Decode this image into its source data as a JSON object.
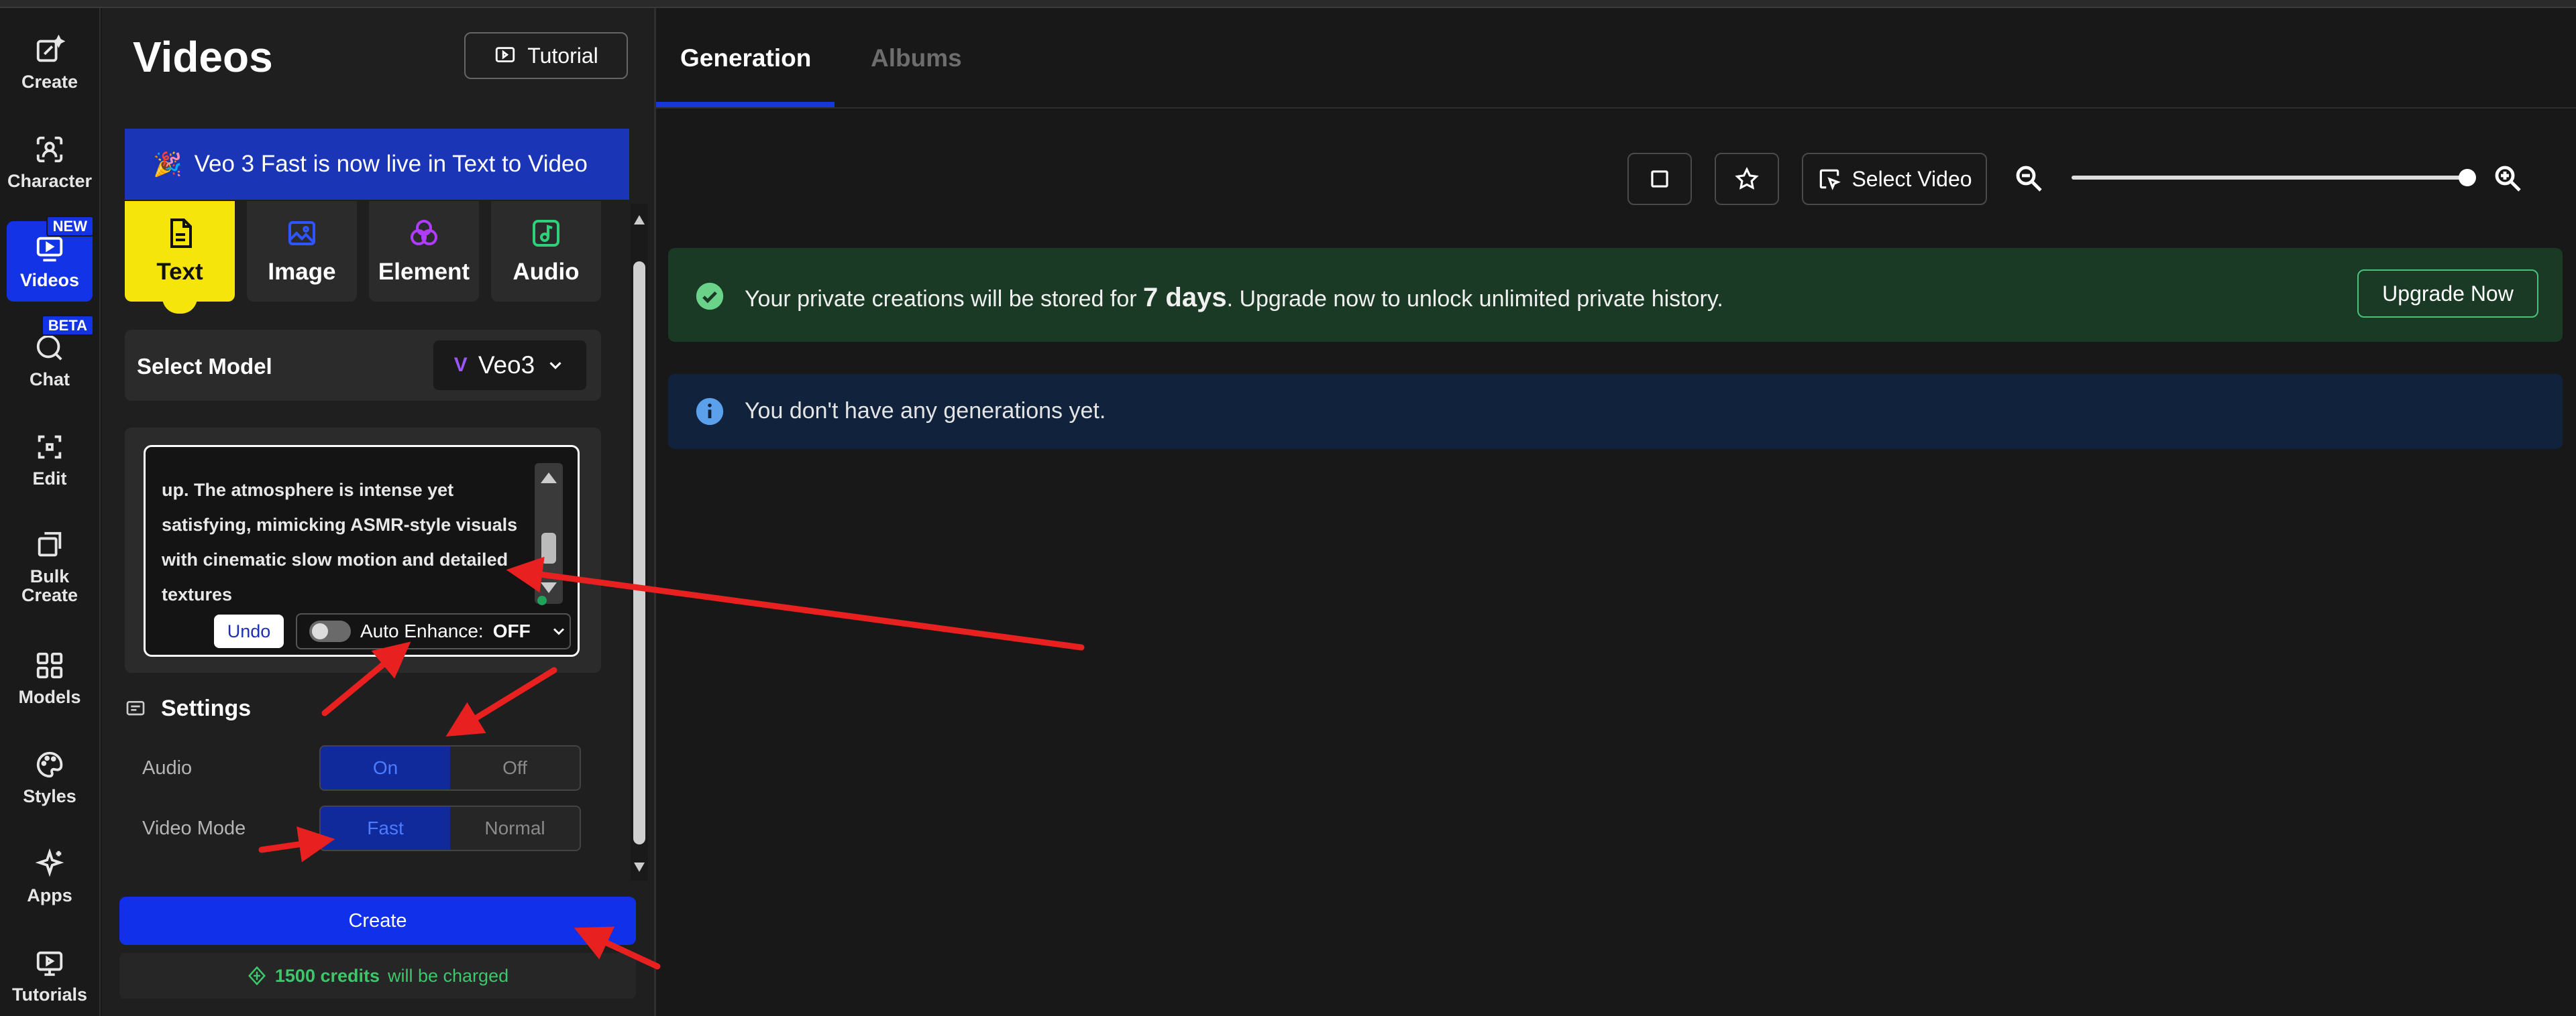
{
  "rail": {
    "items": [
      {
        "label": "Create",
        "icon": "sparkle-edit-icon"
      },
      {
        "label": "Character",
        "icon": "character-scan-icon"
      },
      {
        "label": "Videos",
        "icon": "video-icon",
        "badge": "NEW",
        "active": true
      },
      {
        "label": "Chat",
        "icon": "chat-icon",
        "badge": "BETA"
      },
      {
        "label": "Edit",
        "icon": "edit-crop-icon"
      },
      {
        "label": "Bulk\nCreate",
        "icon": "bulk-create-icon"
      },
      {
        "label": "Models",
        "icon": "grid-icon"
      },
      {
        "label": "Styles",
        "icon": "palette-icon"
      },
      {
        "label": "Apps",
        "icon": "apps-sparkle-icon"
      },
      {
        "label": "Tutorials",
        "icon": "tutorials-icon"
      }
    ]
  },
  "panel": {
    "title": "Videos",
    "tutorial_label": "Tutorial",
    "announcement": "Veo 3 Fast is now live in Text to Video",
    "announcement_emoji": "🎉",
    "tabs": [
      {
        "label": "Text",
        "icon": "document-icon",
        "active": true
      },
      {
        "label": "Image",
        "icon": "image-icon"
      },
      {
        "label": "Element",
        "icon": "element-icon"
      },
      {
        "label": "Audio",
        "icon": "audio-icon"
      }
    ],
    "select_model_label": "Select Model",
    "model_value": "Veo3",
    "prompt_text": "up. The atmosphere is intense yet\nsatisfying, mimicking ASMR-style visuals\nwith cinematic slow motion and detailed\ntextures",
    "undo_label": "Undo",
    "auto_enhance_label": "Auto Enhance:",
    "auto_enhance_value": "OFF",
    "settings_title": "Settings",
    "audio_label": "Audio",
    "audio_on": "On",
    "audio_off": "Off",
    "video_mode_label": "Video Mode",
    "mode_fast": "Fast",
    "mode_normal": "Normal",
    "create_label": "Create",
    "credits_amount": "1500 credits",
    "credits_suffix": "will be charged"
  },
  "main": {
    "tabs": [
      {
        "label": "Generation",
        "active": true
      },
      {
        "label": "Albums",
        "active": false
      }
    ],
    "select_video_label": "Select Video",
    "zoom_level": 1.0,
    "storage_prefix": "Your private creations will be stored for",
    "storage_days": "7 days",
    "storage_suffix": ". Upgrade now to unlock unlimited private history.",
    "upgrade_label": "Upgrade Now",
    "empty_message": "You don't have any generations yet."
  },
  "colors": {
    "accent_blue": "#1030ea",
    "active_tab_yellow": "#f5e50a",
    "success_green": "#3cc76b",
    "annotation_red": "#e8201f"
  }
}
